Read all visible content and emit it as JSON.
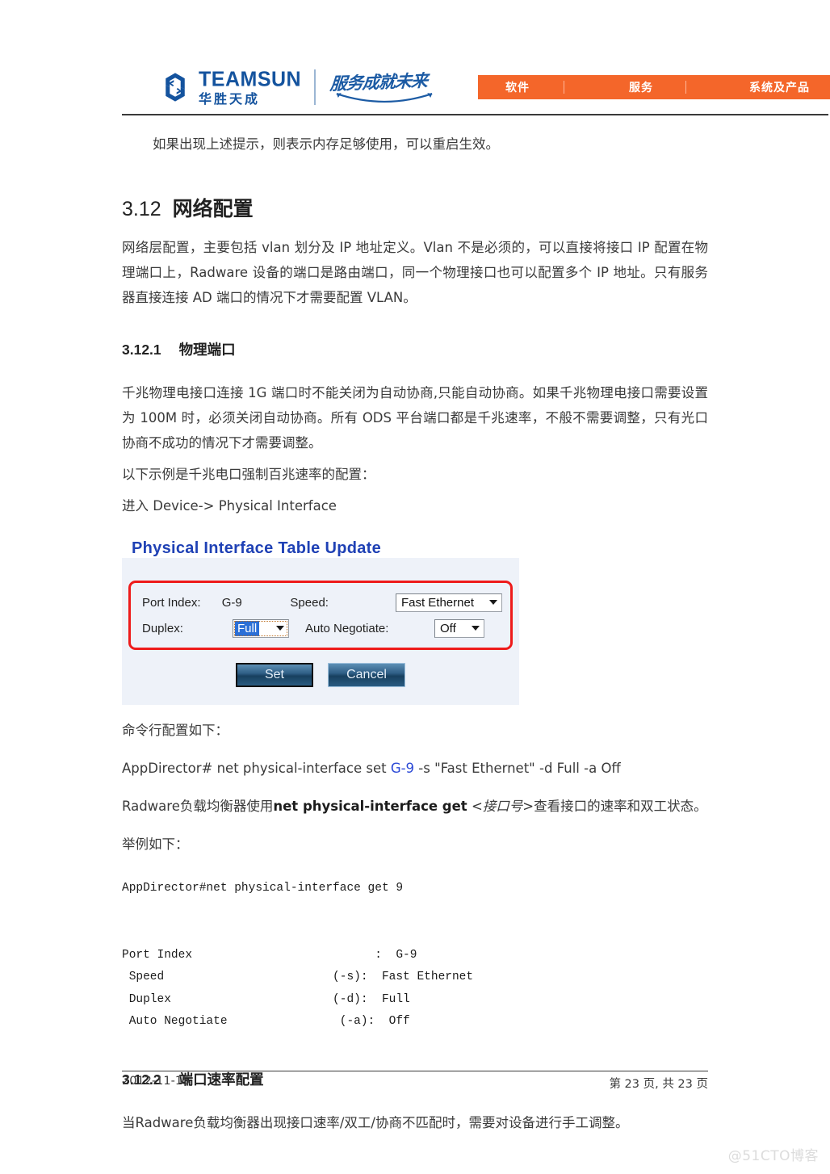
{
  "header": {
    "logo_en": "TEAMSUN",
    "logo_cn": "华胜天成",
    "slogan": "服务成就未来",
    "nav": [
      {
        "label": "软件"
      },
      {
        "label": "服务"
      },
      {
        "label": "系统及产品"
      }
    ]
  },
  "document": {
    "intro_line": "如果出现上述提示，则表示内存足够使用，可以重启生效。",
    "section_312": {
      "number": "3.12",
      "title": "网络配置",
      "paragraph": "网络层配置，主要包括 vlan 划分及 IP 地址定义。Vlan 不是必须的，可以直接将接口 IP 配置在物理端口上，Radware 设备的端口是路由端口，同一个物理接口也可以配置多个 IP 地址。只有服务器直接连接 AD 端口的情况下才需要配置 VLAN。"
    },
    "section_3121": {
      "number": "3.12.1",
      "title": "物理端口",
      "paragraph": "千兆物理电接口连接 1G 端口时不能关闭为自动协商,只能自动协商。如果千兆物理电接口需要设置为 100M 时，必须关闭自动协商。所有 ODS 平台端口都是千兆速率，不般不需要调整，只有光口协商不成功的情况下才需要调整。",
      "example_intro": "以下示例是千兆电口强制百兆速率的配置：",
      "nav_path": "进入 Device-> Physical Interface"
    },
    "section_3122": {
      "number": "3.12.2",
      "title": "端口速率配置",
      "paragraph": "当Radware负载均衡器出现接口速率/双工/协商不匹配时，需要对设备进行手工调整。"
    },
    "cli": {
      "intro": "命令行配置如下：",
      "set_cmd_prefix": "AppDirector# net physical-interface set ",
      "set_cmd_token": "G-9",
      "set_cmd_suffix": " -s \"Fast Ethernet\" -d Full -a Off",
      "get_desc_prefix": "Radware负载均衡器使用",
      "get_desc_bold": "net physical-interface get",
      "get_desc_arg": "<接口号>",
      "get_desc_suffix": "查看接口的速率和双工状态。",
      "example_label": "举例如下：",
      "console_output": "AppDirector#net physical-interface get 9\n\n\nPort Index                          :  G-9\n Speed                        (-s):  Fast Ethernet\n Duplex                       (-d):  Full\n Auto Negotiate                (-a):  Off"
    }
  },
  "dialog": {
    "title": "Physical Interface Table Update",
    "fields": {
      "port_index_label": "Port Index:",
      "port_index_value": "G-9",
      "speed_label": "Speed:",
      "speed_value": "Fast Ethernet",
      "duplex_label": "Duplex:",
      "duplex_value": "Full",
      "auto_negotiate_label": "Auto Negotiate:",
      "auto_negotiate_value": "Off"
    },
    "buttons": {
      "set": "Set",
      "cancel": "Cancel"
    },
    "accent_red": "#ee1b1b",
    "title_blue": "#1f41b5"
  },
  "footer": {
    "date": "2012-11-15",
    "page": "第 23 页, 共 23 页"
  },
  "watermark": "@51CTO博客"
}
